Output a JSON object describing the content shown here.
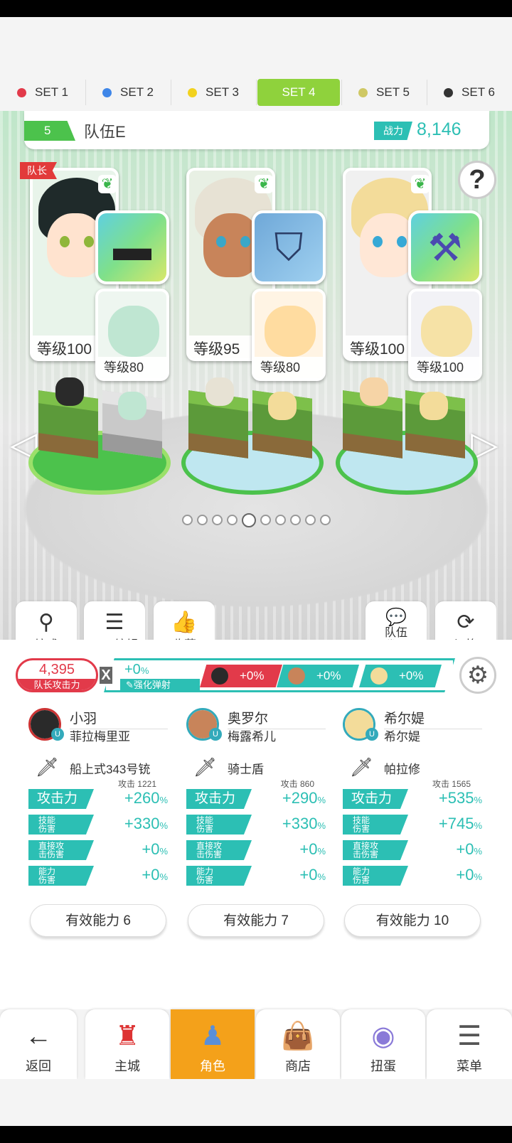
{
  "sets": [
    {
      "label": "SET 1",
      "color": "#e23a4a"
    },
    {
      "label": "SET 2",
      "color": "#3f86e8"
    },
    {
      "label": "SET 3",
      "color": "#f2d21e"
    },
    {
      "label": "SET 4",
      "color": "#8fd23c"
    },
    {
      "label": "SET 5",
      "color": "#cfc864"
    },
    {
      "label": "SET 6",
      "color": "#333333"
    }
  ],
  "active_set": "SET 4",
  "team": {
    "number": "5",
    "name": "队伍E",
    "power_label": "战力",
    "power_value": "8,146"
  },
  "help": {
    "label": "?"
  },
  "cards": [
    {
      "leader_tag": "队长",
      "level": "等级100",
      "sub_level": "等级80"
    },
    {
      "level": "等级95",
      "sub_level": "等级80"
    },
    {
      "level": "等级100",
      "sub_level": "等级100"
    }
  ],
  "actions": {
    "formation": "编成",
    "set_edit": "SET编辑",
    "favorite": "收藏",
    "team_code_1": "队伍",
    "team_code_2": "代码",
    "switch": "切换"
  },
  "stats": {
    "leader_attack_value": "4,395",
    "leader_attack_label": "队长攻击力",
    "multiply": "X",
    "boost_value": "+0",
    "boost_unit": "%",
    "boost_label": "强化弹射",
    "chips": [
      "+0%",
      "+0%",
      "+0%"
    ]
  },
  "heroes": [
    {
      "name": "小羽",
      "sub": "菲拉梅里亚",
      "weapon": "船上式343号铳",
      "atk_base": "攻击  1221",
      "atk_label": "攻击力",
      "atk": "+260",
      "skill_label_1": "技能",
      "skill_label_2": "伤害",
      "skill": "+330",
      "direct_label_1": "直接攻",
      "direct_label_2": "击伤害",
      "direct": "+0",
      "ability_label_1": "能力",
      "ability_label_2": "伤害",
      "ability": "+0",
      "unit": "%",
      "effective": "有效能力 6"
    },
    {
      "name": "奥罗尔",
      "sub": "梅露希儿",
      "weapon": "骑士盾",
      "atk_base": "攻击    860",
      "atk_label": "攻击力",
      "atk": "+290",
      "skill_label_1": "技能",
      "skill_label_2": "伤害",
      "skill": "+330",
      "direct_label_1": "直接攻",
      "direct_label_2": "击伤害",
      "direct": "+0",
      "ability_label_1": "能力",
      "ability_label_2": "伤害",
      "ability": "+0",
      "unit": "%",
      "effective": "有效能力 7"
    },
    {
      "name": "希尔媞",
      "sub": "希尔媞",
      "weapon": "帕拉修",
      "atk_base": "攻击  1565",
      "atk_label": "攻击力",
      "atk": "+535",
      "skill_label_1": "技能",
      "skill_label_2": "伤害",
      "skill": "+745",
      "direct_label_1": "直接攻",
      "direct_label_2": "击伤害",
      "direct": "+0",
      "ability_label_1": "能力",
      "ability_label_2": "伤害",
      "ability": "+0",
      "unit": "%",
      "effective": "有效能力 10"
    }
  ],
  "nav": {
    "back": "返回",
    "town": "主城",
    "character": "角色",
    "shop": "商店",
    "gacha": "扭蛋",
    "menu": "菜单"
  },
  "pager": {
    "total": 10,
    "active": 5
  }
}
